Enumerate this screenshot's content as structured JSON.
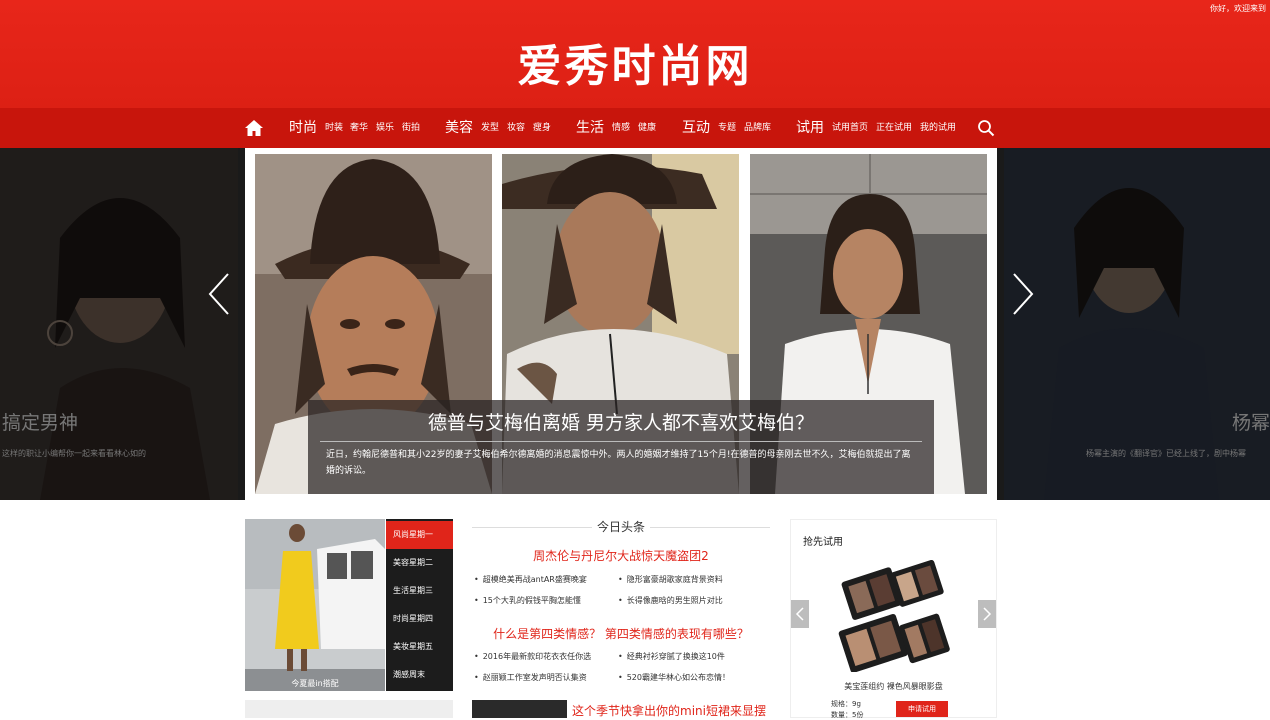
{
  "greeting": "你好，欢迎来到",
  "site_title": "爱秀时尚网",
  "nav": {
    "home_icon": "home-icon",
    "fashion": {
      "label": "时尚",
      "subs": [
        "时装",
        "奢华",
        "娱乐",
        "街拍"
      ]
    },
    "beauty": {
      "label": "美容",
      "subs": [
        "发型",
        "妆容",
        "瘦身"
      ]
    },
    "life": {
      "label": "生活",
      "subs": [
        "情感",
        "健康"
      ]
    },
    "interact": {
      "label": "互动",
      "subs": [
        "专题",
        "品牌库"
      ]
    },
    "trial": {
      "label": "试用",
      "subs": [
        "试用首页",
        "正在试用",
        "我的试用"
      ]
    },
    "search_icon": "search-icon"
  },
  "carousel": {
    "title": "德普与艾梅伯离婚 男方家人都不喜欢艾梅伯？",
    "description": "近日，约翰尼德普和其小22岁的妻子艾梅伯希尔德离婚的消息震惊中外。两人的婚姻才维持了15个月!在德普的母亲刚去世不久，艾梅伯就提出了离婚的诉讼。",
    "left_caption": "搞定男神",
    "left_sub": "这样的职让小编帮你一起来看看林心如的",
    "right_caption": "杨幂",
    "right_sub": "杨幂主演的《翻译官》已经上线了，剧中杨幂"
  },
  "promo": {
    "caption": "今夏最in搭配",
    "menu": [
      "风尚星期一",
      "美容星期二",
      "生活星期三",
      "时尚星期四",
      "美妆星期五",
      "潮感周末"
    ]
  },
  "headlines": {
    "title": "今日头条",
    "groups": [
      {
        "headline": "周杰伦与丹尼尔大战惊天魔盗团2",
        "items": [
          "超模绝美再战antAR盛赛晚宴",
          "隐形富豪胡歌家庭背景资料",
          "15个大乳的假钱平胸怎能懂",
          "长得像鹿晗的男生照片对比"
        ]
      },
      {
        "headline": "什么是第四类情感？ 第四类情感的表现有哪些？",
        "items": [
          "2016年最新款印花衣衣任你选",
          "经典衬衫穿腻了换换这10件",
          "赵丽颖工作室发声明否认集资",
          "520霸建华林心如公布恋情！"
        ]
      },
      {
        "headline": "这个季节快拿出你的mini短裙来显摆",
        "items": []
      }
    ]
  },
  "trial": {
    "title": "抢先试用",
    "product_name": "美宝莲组约 裸色风暴眼影盘",
    "spec": "规格：9g",
    "quantity": "数量：5份",
    "button": "申请试用"
  },
  "colors": {
    "brand_red": "#e0251a",
    "nav_red": "#c8150c"
  }
}
